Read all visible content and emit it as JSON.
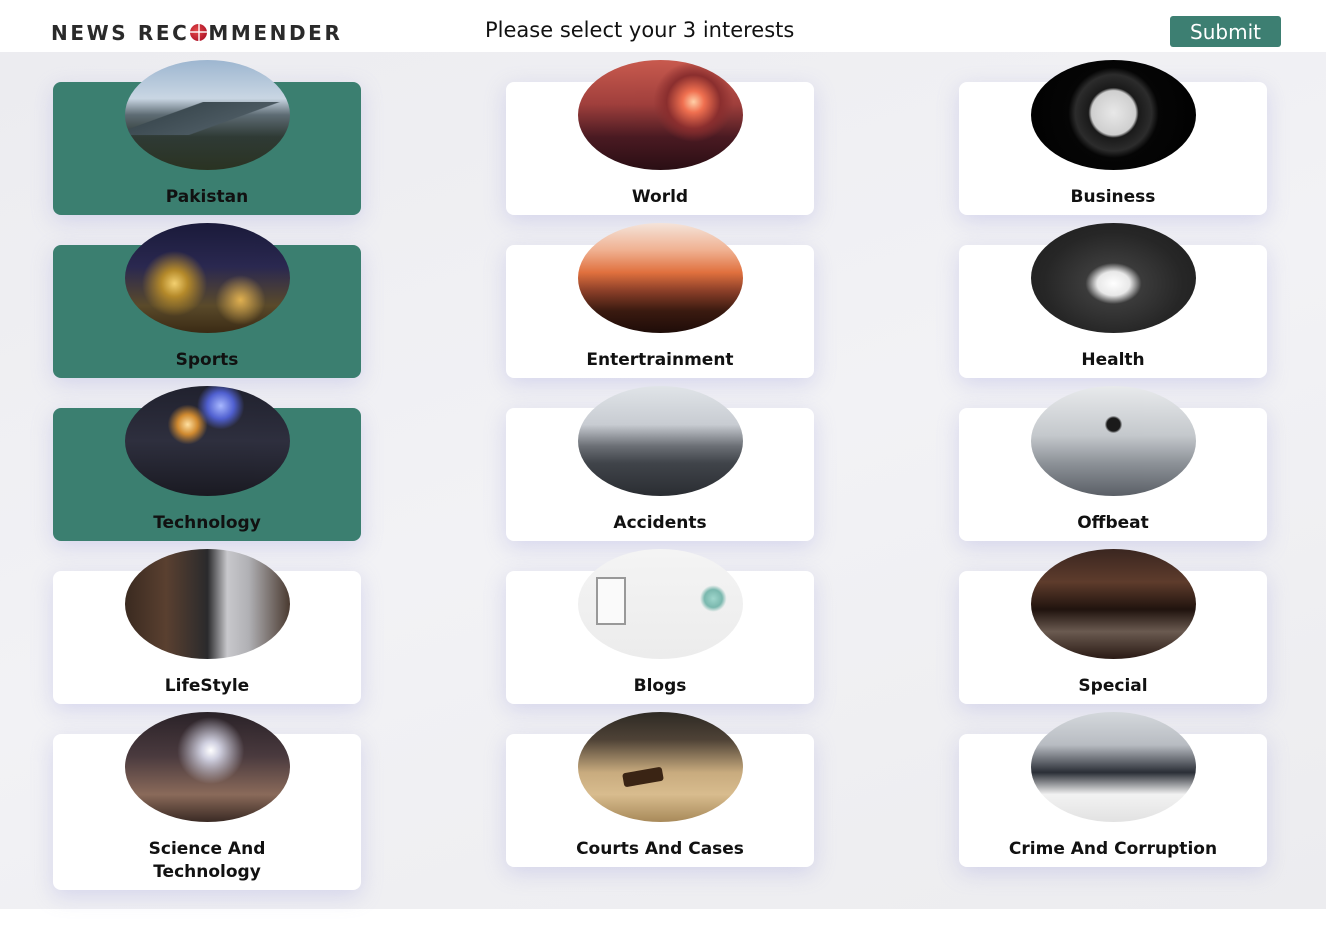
{
  "header": {
    "logo_left": "NEWS REC",
    "logo_right": "MMENDER",
    "prompt": "Please select your 3 interests",
    "submit_label": "Submit"
  },
  "categories": [
    {
      "label": "Pakistan",
      "selected": true,
      "icon": "mountain-landscape-image"
    },
    {
      "label": "World",
      "selected": false,
      "icon": "glass-sphere-sunset-image"
    },
    {
      "label": "Business",
      "selected": false,
      "icon": "alarm-clock-image"
    },
    {
      "label": "Sports",
      "selected": true,
      "icon": "chess-pieces-image"
    },
    {
      "label": "Entertrainment",
      "selected": false,
      "icon": "concert-crowd-image"
    },
    {
      "label": "Health",
      "selected": false,
      "icon": "pills-image"
    },
    {
      "label": "Technology",
      "selected": true,
      "icon": "smartphone-globes-image"
    },
    {
      "label": "Accidents",
      "selected": false,
      "icon": "plane-wreck-image"
    },
    {
      "label": "Offbeat",
      "selected": false,
      "icon": "chess-king-image"
    },
    {
      "label": "LifeStyle",
      "selected": false,
      "icon": "bookshelf-laptop-image"
    },
    {
      "label": "Blogs",
      "selected": false,
      "icon": "desk-notebook-image"
    },
    {
      "label": "Special",
      "selected": false,
      "icon": "coffee-pouring-image"
    },
    {
      "label": "Science And Technology",
      "selected": false,
      "icon": "tech-icons-phone-image"
    },
    {
      "label": "Courts And Cases",
      "selected": false,
      "icon": "gavel-scales-image"
    },
    {
      "label": "Crime And Corruption",
      "selected": false,
      "icon": "money-handover-image"
    }
  ],
  "colors": {
    "accent": "#3b7f70",
    "card": "#ffffff",
    "background": "#efeff2"
  }
}
